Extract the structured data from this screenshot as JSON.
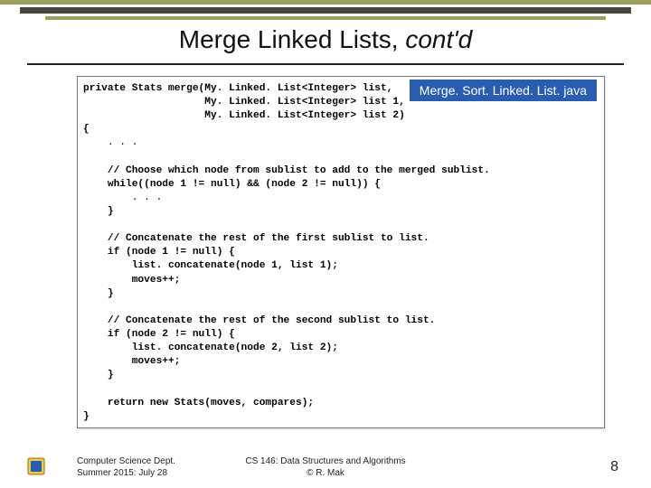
{
  "title": {
    "a": "Merge Linked Lists, ",
    "b": "cont'd"
  },
  "badge": "Merge. Sort. Linked. List. java",
  "code": {
    "l1": "private Stats merge(My. Linked. List<Integer> list,",
    "l2": "                    My. Linked. List<Integer> list 1,",
    "l3": "                    My. Linked. List<Integer> list 2)",
    "l4": "{",
    "l5": "    . . .",
    "l6": "",
    "l7": "    // Choose which node from sublist to add to the merged sublist.",
    "l8": "    while((node 1 != null) && (node 2 != null)) {",
    "l9": "        . . .",
    "l10": "    }",
    "l11": "",
    "l12": "    // Concatenate the rest of the first sublist to list.",
    "l13": "    if (node 1 != null) {",
    "l14": "        list. concatenate(node 1, list 1);",
    "l15": "        moves++;",
    "l16": "    }",
    "l17": "",
    "l18": "    // Concatenate the rest of the second sublist to list.",
    "l19": "    if (node 2 != null) {",
    "l20": "        list. concatenate(node 2, list 2);",
    "l21": "        moves++;",
    "l22": "    }",
    "l23": "",
    "l24": "    return new Stats(moves, compares);",
    "l25": "}"
  },
  "footer": {
    "dept": "Computer Science Dept.",
    "term": "Summer 2015: July 28",
    "course": "CS 146: Data Structures and Algorithms",
    "copy": "© R. Mak",
    "page": "8"
  }
}
